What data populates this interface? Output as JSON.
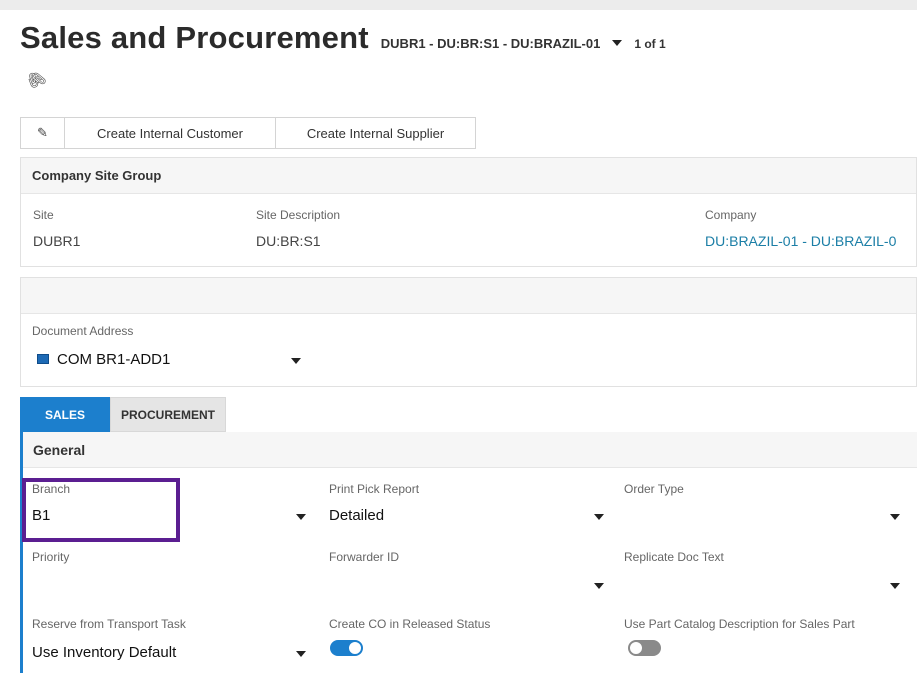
{
  "header": {
    "title": "Sales and Procurement",
    "record_context": "DUBR1 - DU:BR:S1 - DU:BRAZIL-01",
    "record_count": "1 of 1"
  },
  "icons": {
    "attachment": "paperclip-icon",
    "edit": "pencil-icon",
    "dropdown": "caret-down-icon",
    "address": "address-card-icon"
  },
  "toolbar": {
    "edit_glyph": "✎",
    "create_customer_label": "Create Internal Customer",
    "create_supplier_label": "Create Internal Supplier"
  },
  "site_group": {
    "title": "Company Site Group",
    "site_label": "Site",
    "site_value": "DUBR1",
    "site_desc_label": "Site Description",
    "site_desc_value": "DU:BR:S1",
    "company_label": "Company",
    "company_value": "DU:BRAZIL-01 - DU:BRAZIL-0"
  },
  "address": {
    "label": "Document Address",
    "value": "COM BR1-ADD1"
  },
  "tabs": [
    {
      "label": "SALES",
      "active": true
    },
    {
      "label": "PROCUREMENT",
      "active": false
    }
  ],
  "general": {
    "title": "General",
    "branch_label": "Branch",
    "branch_value": "B1",
    "print_pick_label": "Print Pick Report",
    "print_pick_value": "Detailed",
    "order_type_label": "Order Type",
    "order_type_value": "",
    "priority_label": "Priority",
    "priority_value": "",
    "forwarder_label": "Forwarder ID",
    "forwarder_value": "",
    "replicate_label": "Replicate Doc Text",
    "replicate_value": "",
    "reserve_label": "Reserve from Transport Task",
    "reserve_value": "Use Inventory Default",
    "create_co_label": "Create CO in Released Status",
    "create_co_on": true,
    "use_catalog_label": "Use Part Catalog Description for Sales Part",
    "use_catalog_on": false
  },
  "colors": {
    "accent": "#1c7fcd",
    "link": "#1b7ea6",
    "highlight": "#5b1e91"
  }
}
